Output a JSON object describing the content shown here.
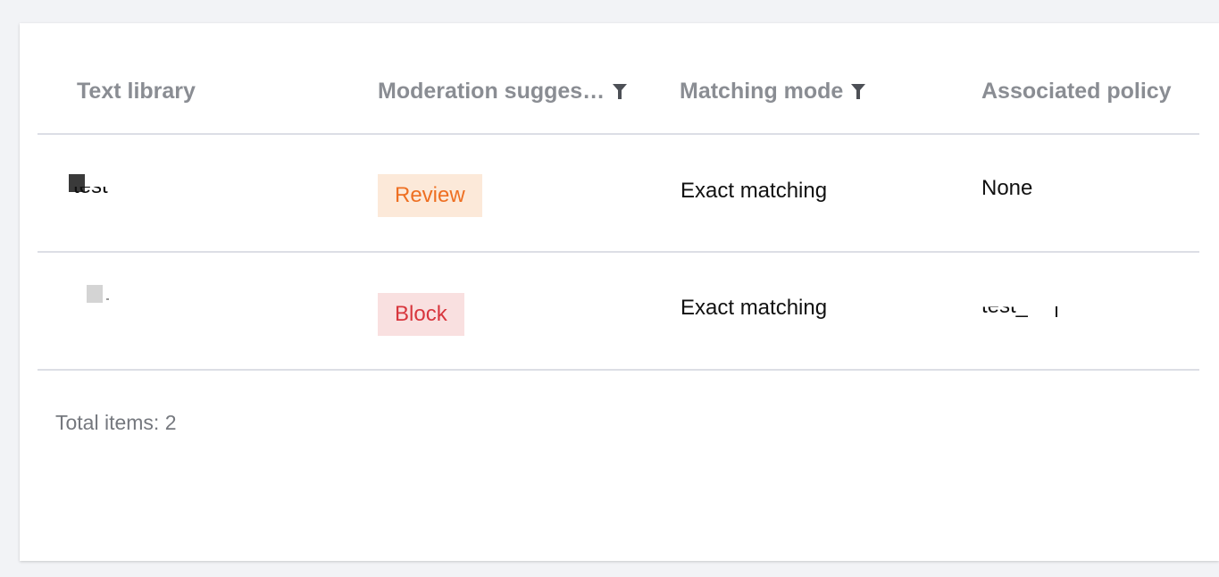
{
  "table": {
    "columns": [
      {
        "label": "Text library",
        "filter": false
      },
      {
        "label": "Moderation sugges…",
        "filter": true
      },
      {
        "label": "Matching mode",
        "filter": true
      },
      {
        "label": "Associated policy",
        "filter": false
      }
    ],
    "rows": [
      {
        "text_library": "test",
        "suggestion": "Review",
        "matching_mode": "Exact matching",
        "policy": "None"
      },
      {
        "text_library": "",
        "suggestion": "Block",
        "matching_mode": "Exact matching",
        "policy": "test_"
      }
    ]
  },
  "footer": {
    "total_label": "Total items:  2"
  },
  "colors": {
    "review_bg": "#fce9d9",
    "review_text": "#ee6f22",
    "block_bg": "#f9e0e0",
    "block_text": "#d8363d",
    "header_text": "#8a8d93",
    "divider": "#dcdee5"
  },
  "icons": {
    "filter": "filter-funnel-icon"
  }
}
